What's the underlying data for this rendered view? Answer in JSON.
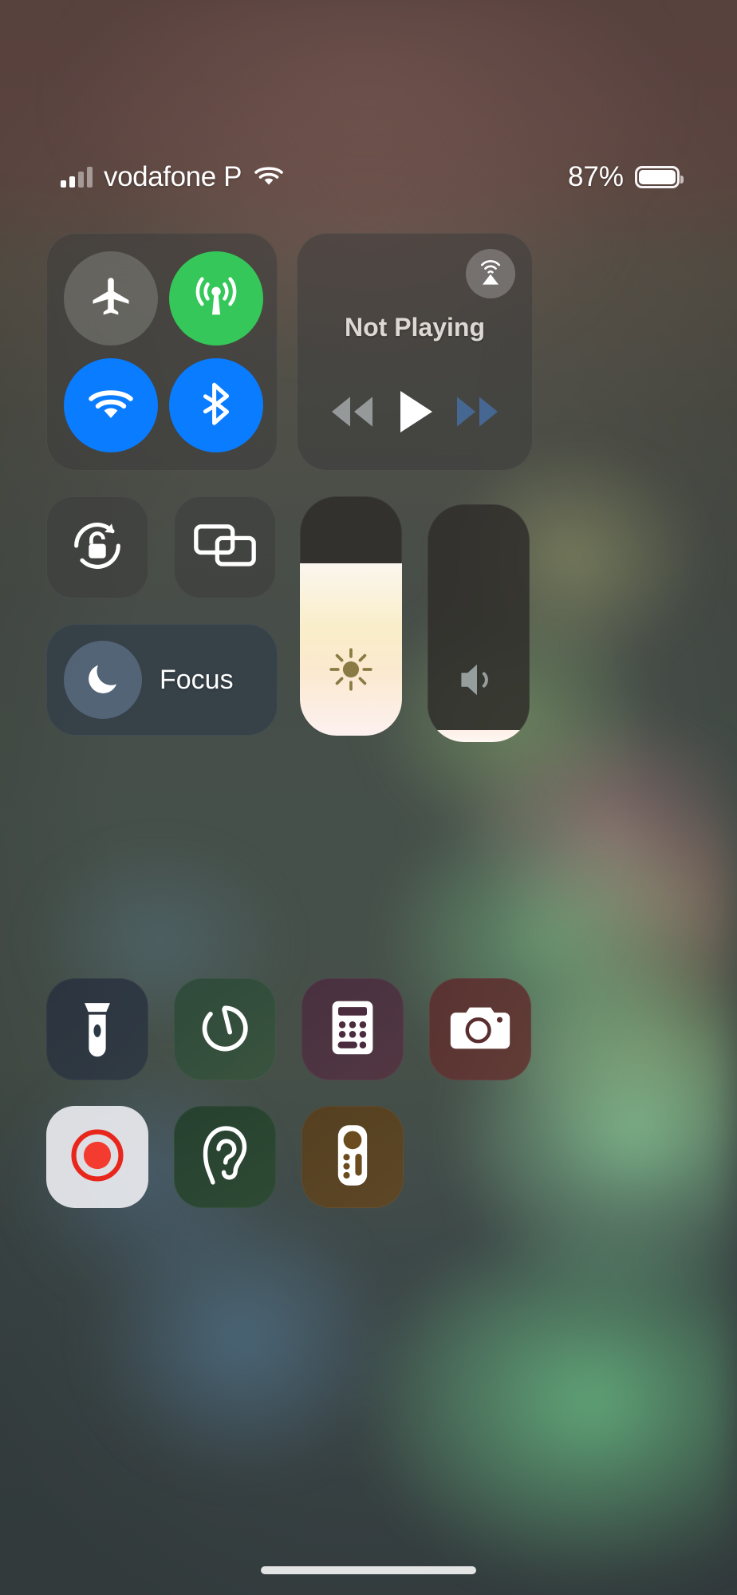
{
  "status_bar": {
    "carrier": "vodafone P",
    "battery_percent": "87%",
    "signal_icon": "cellular-signal-bars-icon",
    "wifi_icon": "wifi-icon",
    "battery_icon": "battery-full-icon",
    "signal_bars_active": 2,
    "signal_bars_total": 4
  },
  "control_center": {
    "connectivity": {
      "name": "connectivity-module",
      "buttons": [
        {
          "name": "airplane-mode-button",
          "icon": "airplane-icon",
          "state": "off",
          "color": "#afb4aa"
        },
        {
          "name": "cellular-data-button",
          "icon": "cellular-antenna-icon",
          "state": "on",
          "color": "#35c759"
        },
        {
          "name": "wifi-button",
          "icon": "wifi-icon",
          "state": "on",
          "color": "#0a7cff"
        },
        {
          "name": "bluetooth-button",
          "icon": "bluetooth-icon",
          "state": "on",
          "color": "#0a7cff"
        }
      ]
    },
    "media": {
      "name": "media-playback-module",
      "title": "Not Playing",
      "airplay_icon": "airplay-audio-icon",
      "controls": [
        {
          "name": "rewind-button",
          "icon": "rewind-icon",
          "state": "dimmed"
        },
        {
          "name": "play-button",
          "icon": "play-icon",
          "state": "active"
        },
        {
          "name": "fast-forward-button",
          "icon": "fast-forward-icon",
          "state": "dimmed"
        }
      ]
    },
    "toggles": [
      {
        "name": "rotation-lock-button",
        "icon": "rotation-lock-icon",
        "state": "off"
      },
      {
        "name": "screen-mirroring-button",
        "icon": "screen-mirroring-icon",
        "state": "off"
      }
    ],
    "focus": {
      "name": "focus-module",
      "label": "Focus",
      "icon": "crescent-moon-icon",
      "state": "off"
    },
    "sliders": [
      {
        "name": "brightness-slider",
        "icon": "brightness-sun-icon",
        "value_percent": 72
      },
      {
        "name": "volume-slider",
        "icon": "speaker-volume-icon",
        "value_percent": 5
      }
    ],
    "shortcuts": [
      {
        "name": "flashlight-button",
        "icon": "flashlight-icon",
        "state": "off"
      },
      {
        "name": "timer-button",
        "icon": "timer-icon",
        "state": "off"
      },
      {
        "name": "calculator-button",
        "icon": "calculator-icon",
        "state": "off"
      },
      {
        "name": "camera-button",
        "icon": "camera-icon",
        "state": "off"
      },
      {
        "name": "screen-recording-button",
        "icon": "screen-record-icon",
        "state": "on",
        "accent": "#f0352b"
      },
      {
        "name": "hearing-button",
        "icon": "ear-hearing-icon",
        "state": "off"
      },
      {
        "name": "apple-tv-remote-button",
        "icon": "tv-remote-icon",
        "state": "off"
      }
    ]
  },
  "home_indicator": {
    "name": "home-indicator"
  }
}
